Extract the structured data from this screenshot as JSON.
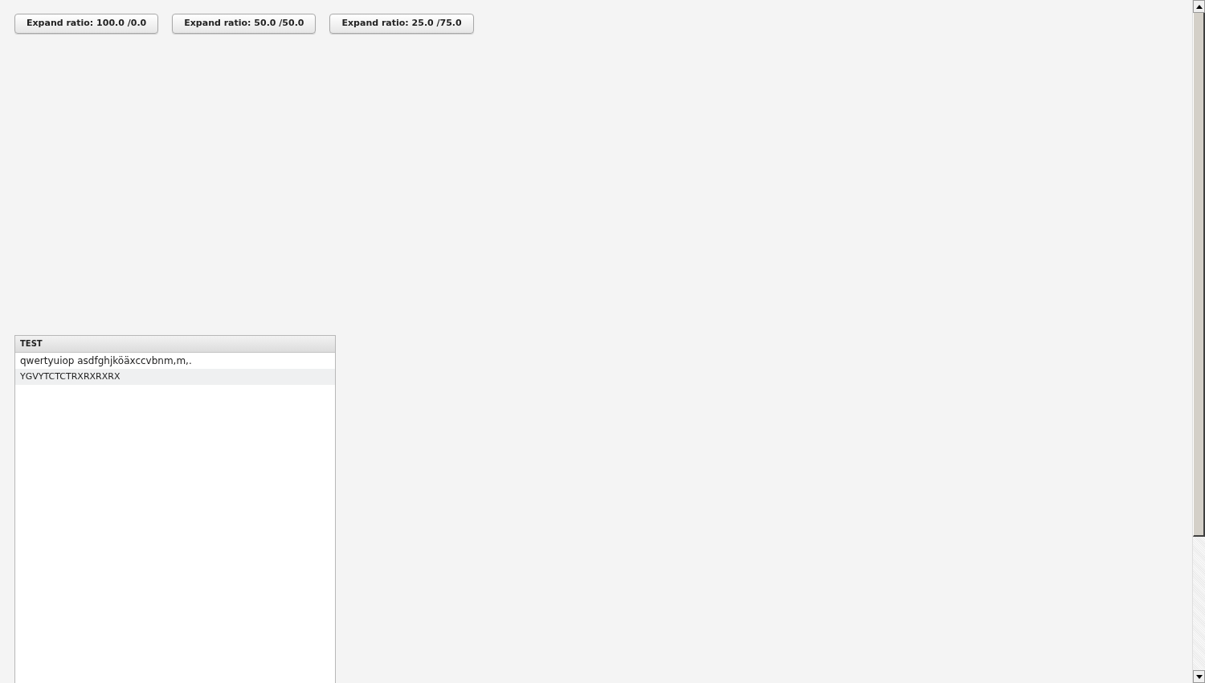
{
  "buttons": [
    {
      "label": "Expand ratio: 100.0 /0.0"
    },
    {
      "label": "Expand ratio: 50.0 /50.0"
    },
    {
      "label": "Expand ratio: 25.0 /75.0"
    }
  ],
  "table": {
    "columns": [
      "TEST"
    ],
    "rows": [
      {
        "cells": [
          "qwertyuiop asdfghjköäxccvbnm,m,."
        ]
      },
      {
        "cells": [
          "YGVYTCTCTRXRXRXRX"
        ]
      }
    ]
  }
}
